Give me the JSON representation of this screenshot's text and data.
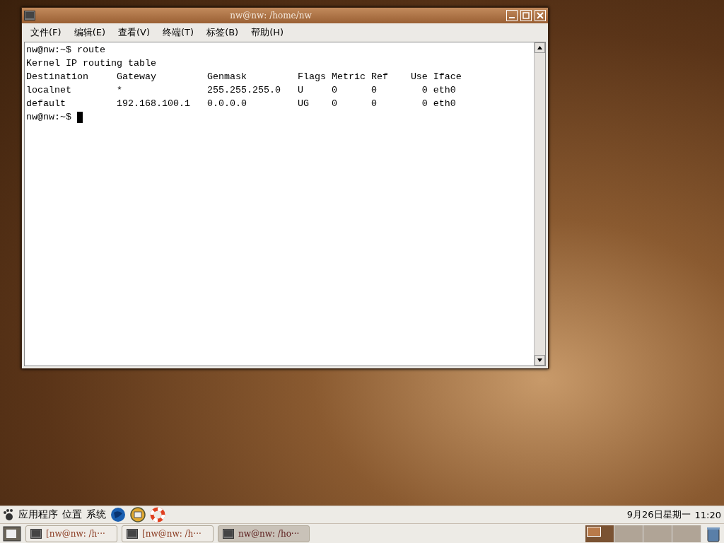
{
  "window": {
    "title": "nw@nw: /home/nw"
  },
  "menu": [
    "文件(F)",
    "编辑(E)",
    "查看(V)",
    "终端(T)",
    "标签(B)",
    "帮助(H)"
  ],
  "terminal": {
    "lines": [
      "nw@nw:~$ route",
      "Kernel IP routing table",
      "Destination     Gateway         Genmask         Flags Metric Ref    Use Iface",
      "localnet        *               255.255.255.0   U     0      0        0 eth0",
      "default         192.168.100.1   0.0.0.0         UG    0      0        0 eth0"
    ],
    "prompt": "nw@nw:~$ "
  },
  "top_panel": {
    "menus": [
      "应用程序",
      "位置",
      "系统"
    ],
    "clock": {
      "date": "9月26日星期一",
      "time": "11:20"
    }
  },
  "taskbar": [
    {
      "label": "[nw@nw: /h···",
      "selected": false
    },
    {
      "label": "[nw@nw: /h···",
      "selected": false
    },
    {
      "label": "nw@nw: /ho···",
      "selected": true
    }
  ],
  "workspaces": [
    {
      "selected": true
    },
    {
      "selected": false
    },
    {
      "selected": false
    },
    {
      "selected": false
    }
  ]
}
